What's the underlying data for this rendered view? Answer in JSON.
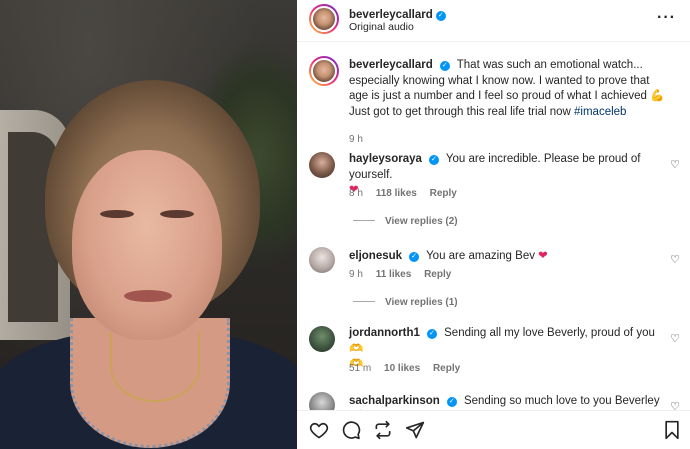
{
  "post": {
    "author": "beverleycallard",
    "audio": "Original audio",
    "more_icon": "more-horizontal-icon"
  },
  "caption": {
    "author": "beverleycallard",
    "text": "That was such an emotional watch... especially knowing what I know now. I wanted to prove that age is just a number and I feel so proud of what I achieved 💪 Just got to get through this real life trial now",
    "hashtag": "#imaceleb",
    "time": "9 h"
  },
  "comments": [
    {
      "author": "hayleysoraya",
      "text": "You are incredible. Please be proud of yourself.",
      "emoji": "❤",
      "time": "8 h",
      "likes": "118 likes",
      "reply": "Reply",
      "view_replies": "View replies (2)"
    },
    {
      "author": "eljonesuk",
      "text": "You are amazing Bev",
      "emoji": "❤",
      "time": "9 h",
      "likes": "11 likes",
      "reply": "Reply",
      "view_replies": "View replies (1)"
    },
    {
      "author": "jordannorth1",
      "text": "Sending all my love Beverly, proud of you",
      "emoji": "🫶",
      "emoji2": "🫶",
      "time": "51 m",
      "likes": "10 likes",
      "reply": "Reply"
    },
    {
      "author": "sachalparkinson",
      "text": "Sending so much love to you Beverley",
      "emoji": "💕"
    }
  ],
  "actions": {
    "like": "heart-icon",
    "comment": "comment-icon",
    "repost": "repost-icon",
    "share": "send-icon",
    "save": "bookmark-icon"
  },
  "colors": {
    "verified": "#0095f6",
    "hashtag": "#00376b",
    "meta": "#737373",
    "heart_emoji": "#e0245e"
  }
}
